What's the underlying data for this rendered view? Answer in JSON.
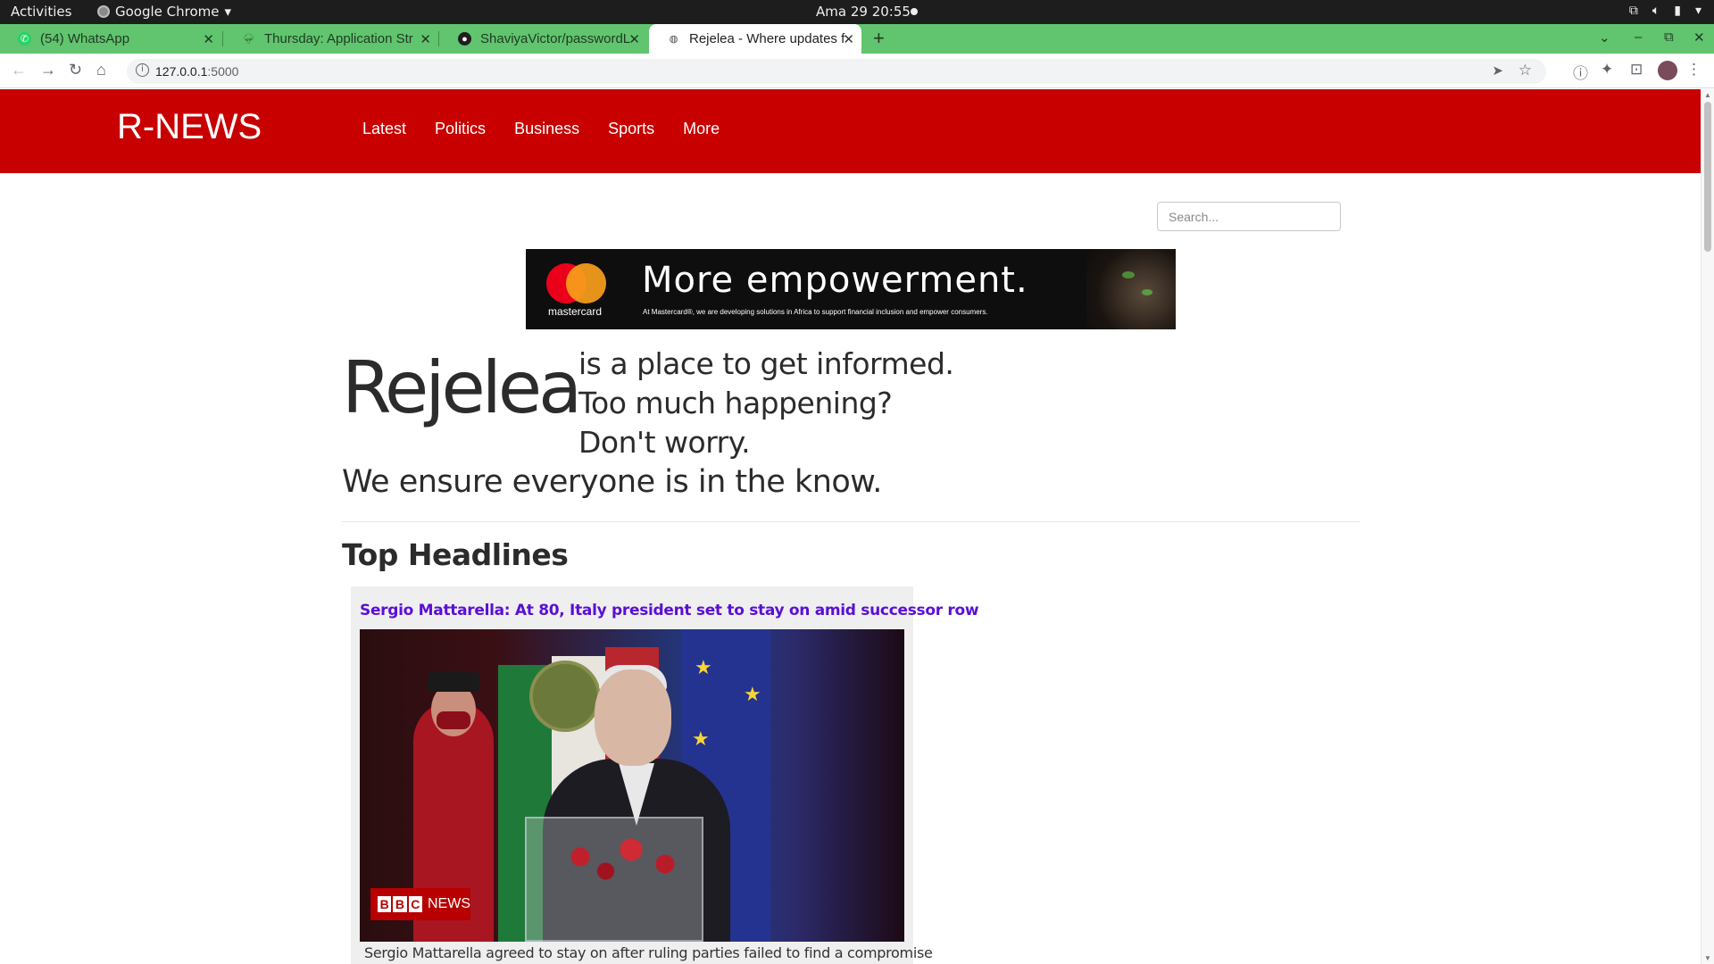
{
  "os": {
    "activities": "Activities",
    "app_name": "Google Chrome",
    "clock": "Ama 29  20:55"
  },
  "browser": {
    "tabs": [
      {
        "title": "(54) WhatsApp",
        "icon": "whatsapp-icon"
      },
      {
        "title": "Thursday: Application Str",
        "icon": "tree-icon"
      },
      {
        "title": "ShaviyaVictor/passwordL",
        "icon": "github-icon"
      },
      {
        "title": "Rejelea - Where updates fl",
        "icon": "globe-icon",
        "active": true
      }
    ],
    "url_host": "127.0.0.1",
    "url_port": ":5000"
  },
  "site": {
    "brand": "R-NEWS",
    "nav": [
      "Latest",
      "Politics",
      "Business",
      "Sports",
      "More"
    ],
    "search_placeholder": "Search...",
    "ad": {
      "brand": "mastercard",
      "headline": "More empowerment.",
      "tagline": "At Mastercard®, we are developing solutions in Africa to support financial inclusion and empower consumers."
    },
    "jumbotron": {
      "big": "Rejelea",
      "line1": "is a place to get informed.",
      "line2": "Too much happening?",
      "line3": "Don't worry.",
      "line4": "We ensure everyone is in the know."
    },
    "section_title": "Top Headlines",
    "articles": [
      {
        "title": "Sergio Mattarella: At 80, Italy president set to stay on amid successor row",
        "image_badge_box": [
          "B",
          "B",
          "C"
        ],
        "image_badge_text": "NEWS",
        "summary": "Sergio Mattarella agreed to stay on after ruling parties failed to find a compromise"
      }
    ]
  },
  "colors": {
    "navbar": "#c80000",
    "tabbar": "#61c46e",
    "article_link": "#5a0fd6"
  }
}
